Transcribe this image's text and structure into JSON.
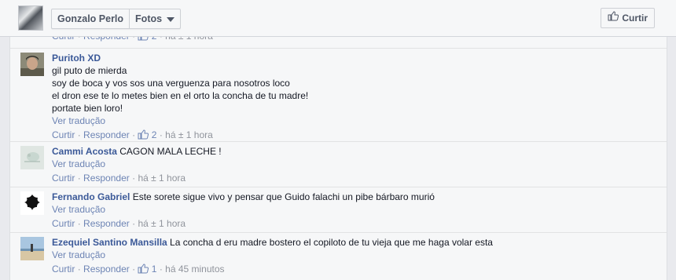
{
  "header": {
    "name_label": "Gonzalo Perlo",
    "section_label": "Fotos",
    "like_label": "Curtir"
  },
  "partial": {
    "curtir": "Curtir",
    "responder": "Responder",
    "likes": "2",
    "time": "há ± 1 hora"
  },
  "comments": [
    {
      "author": "Puritoh XD",
      "lines": [
        "gil puto de mierda",
        "soy de boca y vos sos una verguenza para nosotros loco",
        "el dron ese te lo metes bien en el orto la concha de tu madre!",
        "portate bien loro!"
      ],
      "translate": "Ver tradução",
      "curtir": "Curtir",
      "responder": "Responder",
      "likes": "2",
      "time": "há ± 1 hora"
    },
    {
      "author": "Cammi Acosta",
      "text": "CAGON MALA LECHE !",
      "translate": "Ver tradução",
      "curtir": "Curtir",
      "responder": "Responder",
      "time": "há ± 1 hora"
    },
    {
      "author": "Fernando Gabriel",
      "text": "Este sorete sigue vivo y pensar que Guido falachi un pibe bárbaro murió",
      "translate": "Ver tradução",
      "curtir": "Curtir",
      "responder": "Responder",
      "time": "há ± 1 hora"
    },
    {
      "author": "Ezequiel Santino Mansilla",
      "text": "La concha d eru madre bostero el copiloto de tu vieja que me haga volar esta",
      "translate": "Ver tradução",
      "curtir": "Curtir",
      "responder": "Responder",
      "likes": "1",
      "time": "há 45 minutos"
    }
  ],
  "separator": "·",
  "colors": {
    "link_blue": "#3b5998",
    "meta_gray": "#90949c",
    "panel_bg": "#f6f7f8"
  }
}
